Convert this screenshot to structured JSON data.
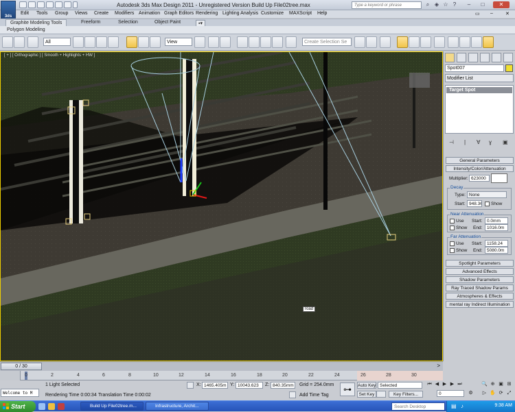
{
  "app": {
    "logo_text": "3ds",
    "window_title": "Autodesk 3ds Max Design 2011  - Unregistered Version    Build Up File02tree.max",
    "search_placeholder": "Type a keyword or phrase"
  },
  "menu": [
    "Edit",
    "Tools",
    "Group",
    "Views",
    "Create",
    "Modifiers",
    "Animation",
    "Graph Editors",
    "Rendering",
    "Lighting Analysis",
    "Customize",
    "MAXScript",
    "Help"
  ],
  "ribbon": {
    "tabs": [
      "Graphite Modeling Tools",
      "Freeform",
      "Selection",
      "Object Paint"
    ],
    "active_panel": "Polygon Modeling"
  },
  "toolbar": {
    "selection_filter": "All",
    "reference_coord": "View",
    "named_selection_placeholder": "Create Selection Se"
  },
  "viewport": {
    "label": "[ + ] [ Orthographic ] [ Smooth + Highlights + HW ]",
    "object_label": "road",
    "border_color": "#f0d000"
  },
  "command_panel": {
    "object_name": "Spot007",
    "object_color": "#f0e030",
    "modifier_list": "Modifier List",
    "stack_item": "Target Spot",
    "rollouts": {
      "general": "General Parameters",
      "intensity": "Intensity/Color/Attenuation",
      "spotlight": "Spotlight Parameters",
      "advanced": "Advanced Effects",
      "shadow": "Shadow Parameters",
      "ray_traced": "Ray Traced Shadow Params",
      "atmospheres": "Atmospheres & Effects",
      "indirect": "mental ray Indirect Illumination"
    },
    "multiplier_label": "Multiplier:",
    "multiplier_value": "623000",
    "decay": {
      "title": "Decay",
      "type_label": "Type:",
      "type_value": "None",
      "start_label": "Start:",
      "start_value": "948.36",
      "show_label": "Show"
    },
    "near": {
      "title": "Near Attenuation",
      "use_label": "Use",
      "show_label": "Show",
      "start_label": "Start:",
      "start_value": "0.0mm",
      "end_label": "End:",
      "end_value": "1016.0m"
    },
    "far": {
      "title": "Far Attenuation",
      "use_label": "Use",
      "show_label": "Show",
      "start_label": "Start:",
      "start_value": "1158.24",
      "end_label": "End:",
      "end_value": "5080.0m"
    }
  },
  "timeline": {
    "frame_display": "0 / 30",
    "ticks": [
      "0",
      "2",
      "4",
      "6",
      "8",
      "10",
      "12",
      "14",
      "16",
      "18",
      "20",
      "22",
      "24",
      "26",
      "28",
      "30"
    ]
  },
  "status": {
    "maxscript_text": "Welcome to M",
    "selection_text": "1 Light Selected",
    "render_time": "Rendering Time  0:00:34",
    "translation_time": "Translation Time  0:00:02",
    "x_label": "X:",
    "x_value": "1465.405m",
    "y_label": "Y:",
    "y_value": "10043.623",
    "z_label": "Z:",
    "z_value": "840.35mm",
    "grid": "Grid = 254.0mm",
    "add_time_tag": "Add Time Tag",
    "auto_key": "Auto Key",
    "set_key": "Set Key",
    "selected": "Selected",
    "key_filters": "Key Filters...",
    "current_frame": "0"
  },
  "taskbar": {
    "start": "Start",
    "tasks": [
      "Build Up File02tree.m...",
      "Infrastructure, Archit..."
    ],
    "search_placeholder": "Search Desktop",
    "clock": "9:38 AM"
  }
}
